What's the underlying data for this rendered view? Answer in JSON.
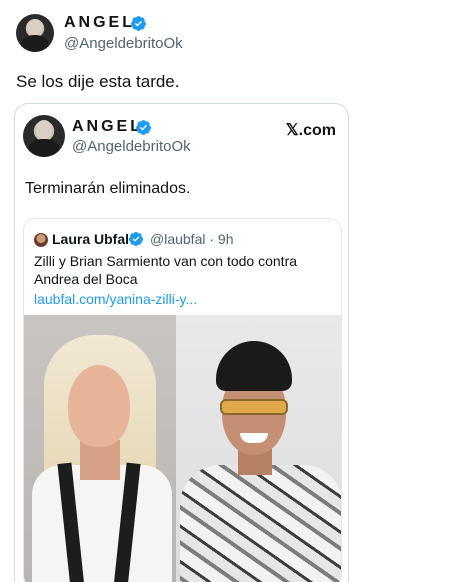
{
  "outer_tweet": {
    "author_name": "ANGEL",
    "author_handle": "@AngeldebritoOk",
    "text": "Se los dije esta tarde."
  },
  "embedded_card": {
    "author_name": "ANGEL",
    "author_handle": "@AngeldebritoOk",
    "source_label": "𝕏.com",
    "text": "Terminarán eliminados.",
    "quoted_tweet": {
      "author_name": "Laura Ubfal",
      "author_handle": "@laubfal · 9h",
      "text_line1": "Zilli y  Brian Sarmiento van con todo contra",
      "text_line2": "Andrea del Boca",
      "link_text": "laubfal.com/yanina-zilli-y..."
    }
  },
  "colors": {
    "verified": "#1d9bf0",
    "link": "#1d9bf0",
    "muted": "#536471",
    "text": "#0f1419"
  },
  "icons": [
    "verified-badge-icon"
  ]
}
